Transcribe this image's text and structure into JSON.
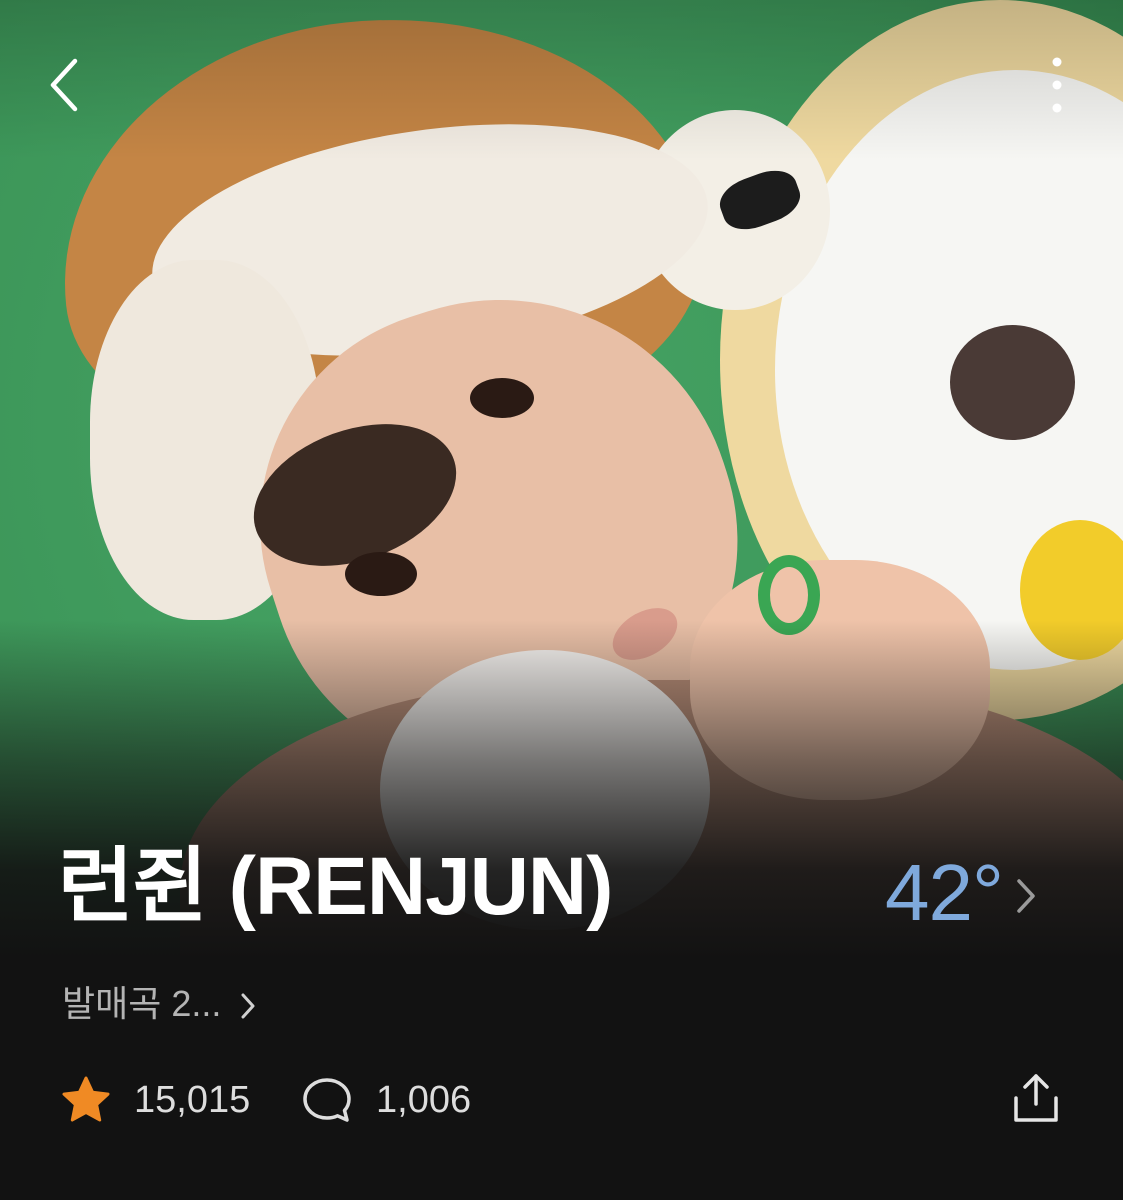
{
  "header": {
    "back_icon": "chevron-left-icon",
    "more_icon": "vertical-dots-icon"
  },
  "artist": {
    "name": "런쥔 (RENJUN)",
    "temperature": "42°",
    "temperature_color": "#7fa9dc",
    "subtitle": "발매곡 2..."
  },
  "stats": {
    "likes_icon": "star-icon",
    "likes_icon_color": "#f08a24",
    "likes": "15,015",
    "comments_icon": "comment-bubble-icon",
    "comments": "1,006",
    "share_icon": "share-icon"
  },
  "colors": {
    "background": "#121212",
    "photo_backdrop": "#3f9a5d"
  }
}
